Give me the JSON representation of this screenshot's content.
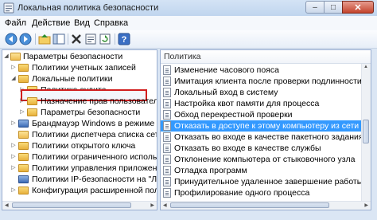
{
  "window": {
    "title": "Локальная политика безопасности",
    "icon": "policy-app-icon",
    "controls": {
      "minimize": "–",
      "maximize": "□",
      "close": "✕"
    }
  },
  "menu": [
    "Файл",
    "Действие",
    "Вид",
    "Справка"
  ],
  "toolbar": {
    "icons": [
      "back-arrow-icon",
      "forward-arrow-icon",
      "up-folder-icon",
      "show-hide-tree-icon",
      "delete-icon",
      "properties-icon",
      "refresh-icon",
      "help-icon"
    ]
  },
  "tree": {
    "root": "Параметры безопасности",
    "items": [
      {
        "label": "Политики учетных записей",
        "level": 1,
        "expanded": false
      },
      {
        "label": "Локальные политики",
        "level": 1,
        "expanded": true
      },
      {
        "label": "Политика аудита",
        "level": 2,
        "expanded": false
      },
      {
        "label": "Назначение прав пользователя",
        "level": 2,
        "expanded": false,
        "selected": true
      },
      {
        "label": "Параметры безопасности",
        "level": 2,
        "expanded": false
      },
      {
        "label": "Брандмауэр Windows в режиме",
        "level": 1,
        "expanded": false
      },
      {
        "label": "Политики диспетчера списка сетей",
        "level": 1,
        "expanded": false
      },
      {
        "label": "Политики открытого ключа",
        "level": 1,
        "expanded": false
      },
      {
        "label": "Политики ограниченного использова",
        "level": 1,
        "expanded": false
      },
      {
        "label": "Политики управления приложениям",
        "level": 1,
        "expanded": false
      },
      {
        "label": "Политики IP-безопасности на \"Локальн",
        "level": 1,
        "expanded": false
      },
      {
        "label": "Конфигурация расширенной полити",
        "level": 1,
        "expanded": false
      }
    ]
  },
  "list": {
    "column_header": "Политика",
    "rows": [
      {
        "label": "Изменение часового пояса"
      },
      {
        "label": "Имитация клиента после проверки подлинности"
      },
      {
        "label": "Локальный вход в систему"
      },
      {
        "label": "Настройка квот памяти для процесса"
      },
      {
        "label": "Обход перекрестной проверки"
      },
      {
        "label": "Отказать в доступе к этому компьютеру из сети",
        "active": true
      },
      {
        "label": "Отказать во входе в качестве пакетного задания"
      },
      {
        "label": "Отказать во входе в качестве службы"
      },
      {
        "label": "Отклонение компьютера от стыковочного узла"
      },
      {
        "label": "Отладка программ"
      },
      {
        "label": "Принудительное удаленное завершение работы"
      },
      {
        "label": "Профилирование одного процесса"
      }
    ]
  },
  "colors": {
    "selection": "#3399ff",
    "highlight_border": "#d11f1f",
    "title_bar": "#c8daf0"
  }
}
